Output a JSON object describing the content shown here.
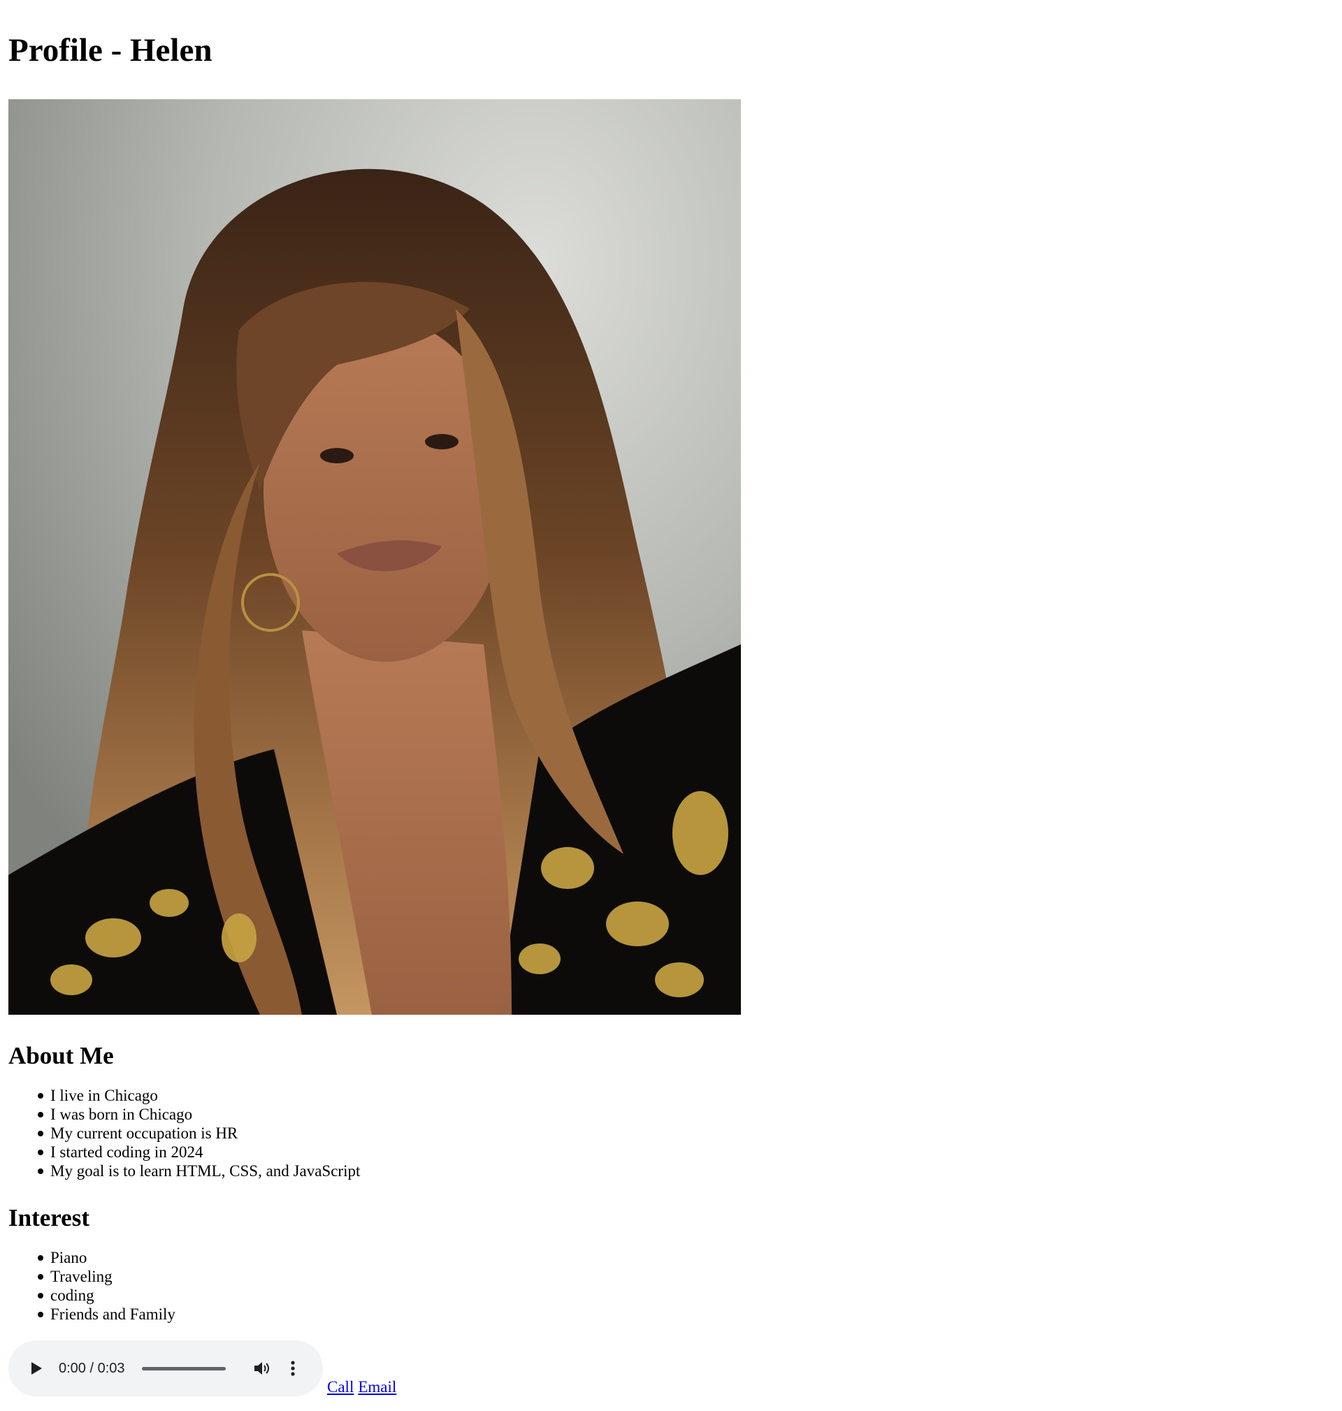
{
  "page": {
    "title": "Profile - Helen"
  },
  "about": {
    "heading": "About Me",
    "items": [
      "I live in Chicago",
      "I was born in Chicago",
      "My current occupation is HR",
      "I started coding in 2024",
      "My goal is to learn HTML, CSS, and JavaScript"
    ]
  },
  "interest": {
    "heading": "Interest",
    "items": [
      "Piano",
      "Traveling",
      "coding",
      "Friends and Family"
    ]
  },
  "audio": {
    "time_display": "0:00 / 0:03",
    "progress": 0,
    "play_icon": "play-icon",
    "volume_icon": "volume-icon",
    "more_icon": "more-vertical-icon"
  },
  "links": {
    "call_label": "Call",
    "email_label": "Email"
  },
  "colors": {
    "link": "#0000ee",
    "player_background": "#f1f3f4"
  }
}
